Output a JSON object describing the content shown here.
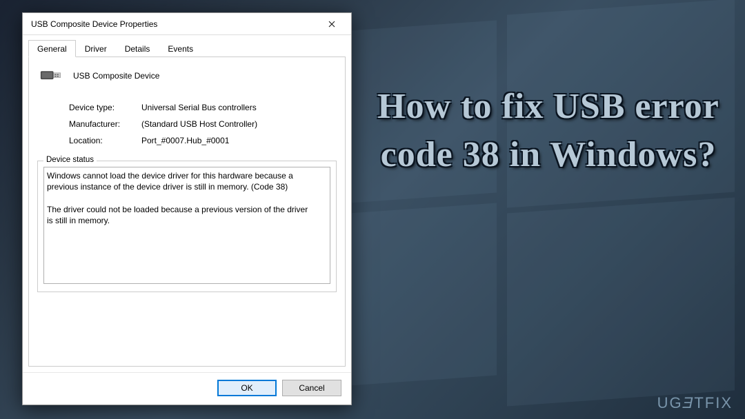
{
  "headline": "How to fix USB error code 38 in Windows?",
  "watermark": "UG🔄TFIX",
  "dialog": {
    "title": "USB Composite Device Properties",
    "tabs": [
      "General",
      "Driver",
      "Details",
      "Events"
    ],
    "active_tab": 0,
    "device_name": "USB Composite Device",
    "fields": {
      "type_label": "Device type:",
      "type_value": "Universal Serial Bus controllers",
      "manuf_label": "Manufacturer:",
      "manuf_value": "(Standard USB Host Controller)",
      "loc_label": "Location:",
      "loc_value": "Port_#0007.Hub_#0001"
    },
    "status_legend": "Device status",
    "status_text": "Windows cannot load the device driver for this hardware because a previous instance of the device driver is still in memory. (Code 38)\n\nThe driver could not be loaded because a previous version of the driver is still in memory.",
    "ok": "OK",
    "cancel": "Cancel"
  }
}
